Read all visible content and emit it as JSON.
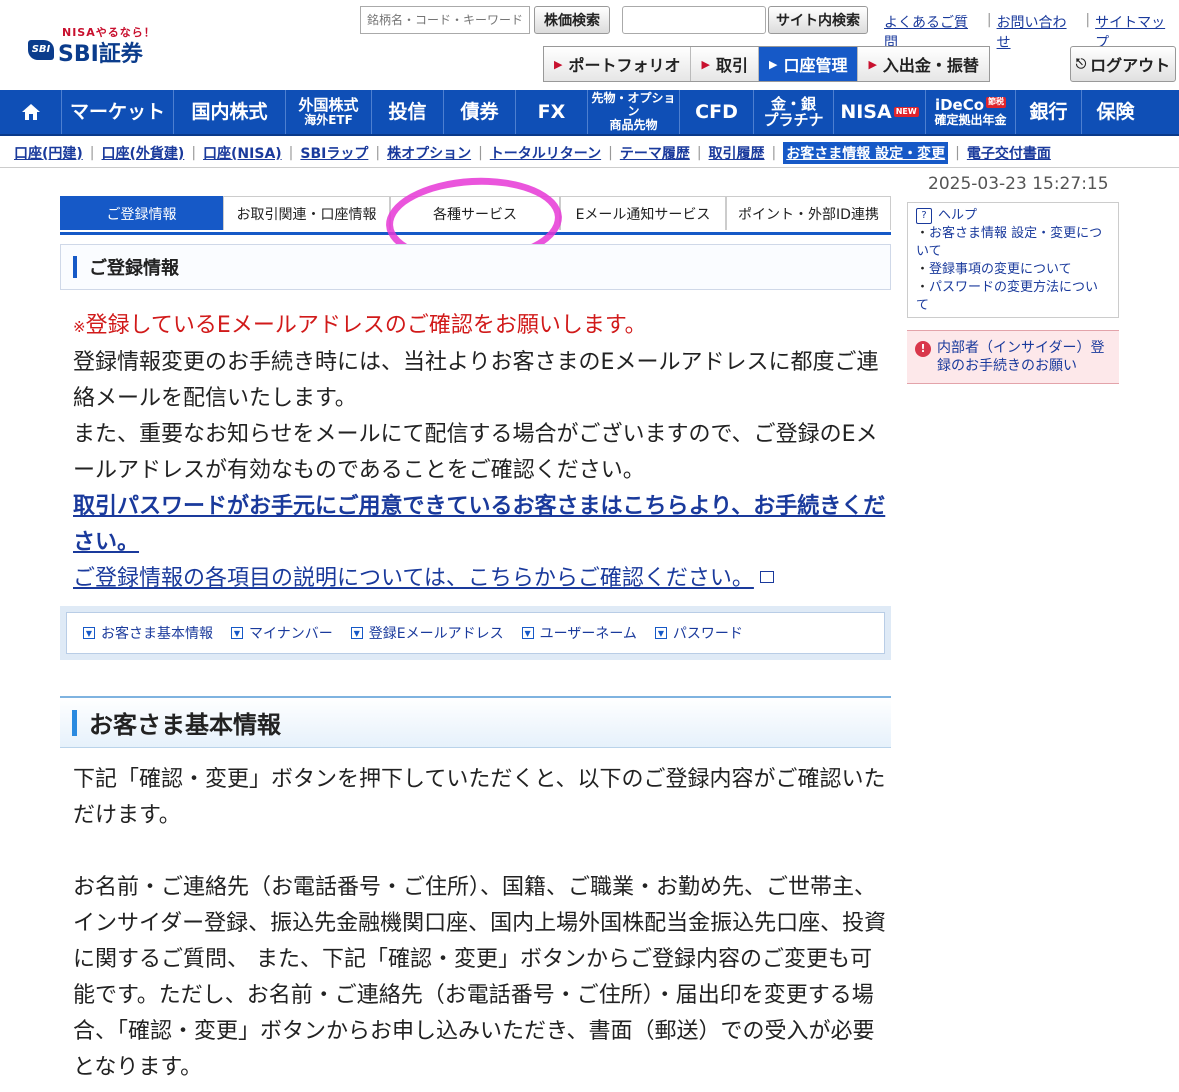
{
  "header": {
    "logo_tagline": "NISAやるなら！",
    "logo_mark": "SBI",
    "logo_name": "SBI証券",
    "stock_search_placeholder": "銘柄名・コード・キーワード",
    "stock_search_button": "株価検索",
    "site_search_button": "サイト内検索",
    "links": [
      "よくあるご質問",
      "お問い合わせ",
      "サイトマップ"
    ],
    "main_nav": [
      "ポートフォリオ",
      "取引",
      "口座管理",
      "入出金・振替"
    ],
    "main_nav_active": "口座管理",
    "logout": "ログアウト"
  },
  "global_nav": {
    "home_icon": "home-icon",
    "items": [
      {
        "label": "マーケット"
      },
      {
        "label": "国内株式"
      },
      {
        "label": "外国株式",
        "sub": "海外ETF"
      },
      {
        "label": "投信"
      },
      {
        "label": "債券"
      },
      {
        "label": "FX"
      },
      {
        "label": "先物・オプション",
        "sub": "商品先物"
      },
      {
        "label": "CFD"
      },
      {
        "label": "金・銀",
        "sub": "プラチナ"
      },
      {
        "label": "NISA",
        "badge": "NEW"
      },
      {
        "label": "iDeCo",
        "badge": "節税",
        "sub": "確定拠出年金"
      },
      {
        "label": "銀行"
      },
      {
        "label": "保険"
      }
    ]
  },
  "sub_nav": {
    "items": [
      "口座(円建)",
      "口座(外貨建)",
      "口座(NISA)",
      "SBIラップ",
      "株オプション",
      "トータルリターン",
      "テーマ履歴",
      "取引履歴",
      "お客さま情報 設定・変更",
      "電子交付書面"
    ],
    "current": "お客さま情報 設定・変更"
  },
  "timestamp": "2025-03-23 15:27:15",
  "tabs": {
    "items": [
      "ご登録情報",
      "お取引関連・口座情報",
      "各種サービス",
      "Eメール通知サービス",
      "ポイント・外部ID連携"
    ],
    "active": "ご登録情報"
  },
  "section_title": "ご登録情報",
  "notice": {
    "warning_mark": "※",
    "warning": "登録しているEメールアドレスのご確認をお願いします。",
    "line1": "登録情報変更のお手続き時には、当社よりお客さまのEメールアドレスに都度ご連絡メールを配信いたします。",
    "line2": "また、重要なお知らせをメールにて配信する場合がございますので、ご登録のEメールアドレスが有効なものであることをご確認ください。",
    "password_link": "取引パスワードがお手元にご用意できているお客さまはこちらより、お手続きください。",
    "explain_link": "ご登録情報の各項目の説明については、こちらからご確認ください。"
  },
  "anchors": [
    "お客さま基本情報",
    "マイナンバー",
    "登録Eメールアドレス",
    "ユーザーネーム",
    "パスワード"
  ],
  "basic_info": {
    "title": "お客さま基本情報",
    "p1": "下記「確認・変更」ボタンを押下していただくと、以下のご登録内容がご確認いただけます。",
    "p2": "お名前・ご連絡先（お電話番号・ご住所）、国籍、ご職業・お勤め先、ご世帯主、インサイダー登録、振込先金融機関口座、国内上場外国株配当金振込先口座、投資に関するご質問、 また、下記「確認・変更」ボタンからご登録内容のご変更も可能です。ただし、お名前・ご連絡先（お電話番号・ご住所）・届出印を変更する場合、「確認・変更」ボタンからお申し込みいただき、書面（郵送）での受入が必要となります。"
  },
  "sidebar": {
    "help_title": "ヘルプ",
    "help_links": [
      "お客さま情報 設定・変更について",
      "登録事項の変更について",
      "パスワードの変更方法について"
    ],
    "alert_link": "内部者（インサイダー）登録のお手続きのお願い"
  },
  "colors": {
    "brand_blue": "#0f4fb6",
    "active_blue": "#1659c7",
    "warning_red": "#d11a1a",
    "highlight_magenta": "#e637d6"
  }
}
